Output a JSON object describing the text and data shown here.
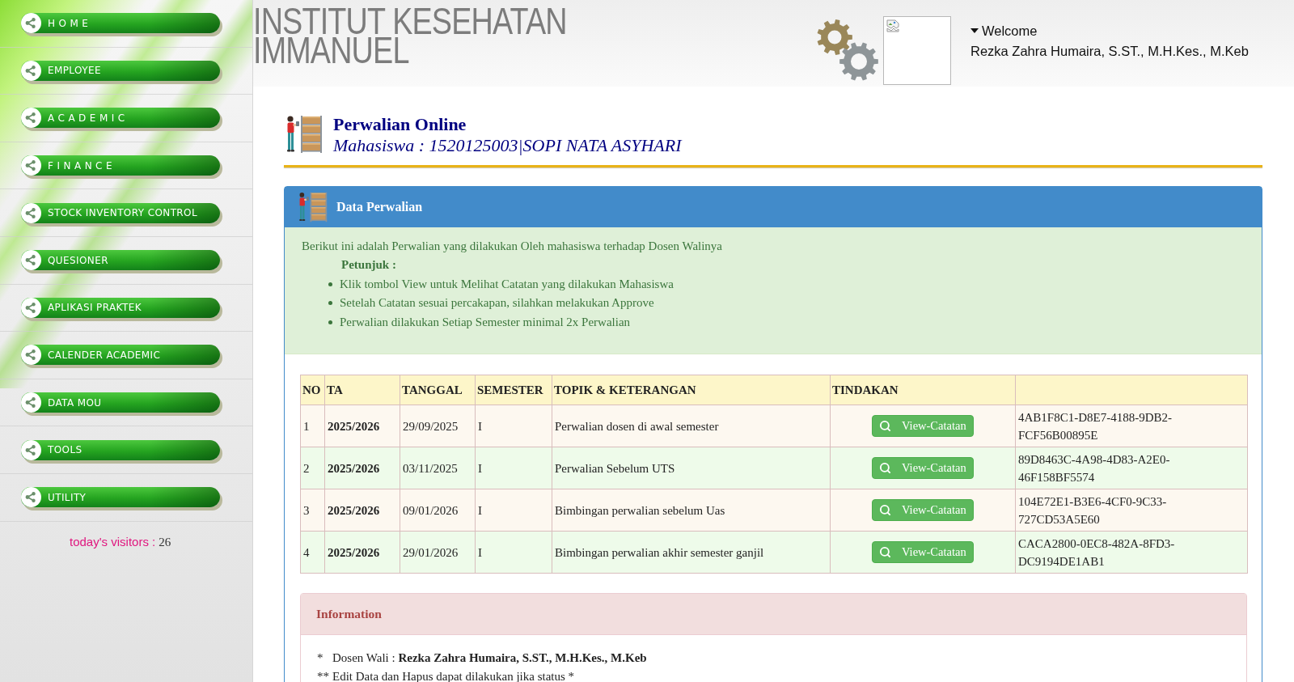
{
  "sidebar": {
    "menu": [
      {
        "label": "HOME",
        "kind": "spaced"
      },
      {
        "label": "EMPLOYEE",
        "kind": "plain"
      },
      {
        "label": "ACADEMIC",
        "kind": "spaced"
      },
      {
        "label": "FINANCE",
        "kind": "spaced"
      },
      {
        "label": "STOCK INVENTORY CONTROL",
        "kind": "plain"
      },
      {
        "label": "QUESIONER",
        "kind": "plain"
      },
      {
        "label": "APLIKASI PRAKTEK",
        "kind": "plain"
      },
      {
        "label": "CALENDER ACADEMIC",
        "kind": "plain"
      },
      {
        "label": "DATA MOU",
        "kind": "plain"
      },
      {
        "label": "TOOLS",
        "kind": "plain"
      },
      {
        "label": "UTILITY",
        "kind": "plain"
      }
    ],
    "visitors": {
      "label": "today's visitors :",
      "count": "26"
    }
  },
  "header": {
    "logo": [
      "INSTITUT KESEHATAN",
      "IMMANUEL"
    ],
    "welcome": "Welcome",
    "user_name": "Rezka Zahra Humaira, S.ST., M.H.Kes., M.Keb"
  },
  "page": {
    "title": "Perwalian Online",
    "subtitle": "Mahasiswa : 1520125003|SOPI NATA ASYHARI"
  },
  "panel": {
    "title": "Data Perwalian",
    "intro": "Berikut ini adalah Perwalian yang dilakukan Oleh mahasiswa terhadap Dosen Walinya",
    "hint_title": "Petunjuk :",
    "hints": [
      "Klik tombol View untuk Melihat Catatan yang dilakukan Mahasiswa",
      "Setelah Catatan sesuai percakapan, silahkan melakukan Approve",
      "Perwalian dilakukan Setiap Semester minimal 2x Perwalian"
    ]
  },
  "table": {
    "columns": [
      "NO",
      "TA",
      "TANGGAL",
      "SEMESTER",
      "TOPIK & KETERANGAN",
      "TINDAKAN"
    ],
    "rows": [
      {
        "no": "1",
        "ta": "2025/2026",
        "tanggal": "29/09/2025",
        "semester": "I",
        "topik": "Perwalian dosen di awal semester",
        "action": "View-Catatan",
        "code": "4AB1F8C1-D8E7-4188-9DB2-FCF56B00895E"
      },
      {
        "no": "2",
        "ta": "2025/2026",
        "tanggal": "03/11/2025",
        "semester": "I",
        "topik": "Perwalian Sebelum UTS",
        "action": "View-Catatan",
        "code": "89D8463C-4A98-4D83-A2E0-46F158BF5574"
      },
      {
        "no": "3",
        "ta": "2025/2026",
        "tanggal": "09/01/2026",
        "semester": "I",
        "topik": "Bimbingan perwalian sebelum Uas",
        "action": "View-Catatan",
        "code": "104E72E1-B3E6-4CF0-9C33-727CD53A5E60"
      },
      {
        "no": "4",
        "ta": "2025/2026",
        "tanggal": "29/01/2026",
        "semester": "I",
        "topik": "Bimbingan perwalian akhir semester ganjil",
        "action": "View-Catatan",
        "code": "CACA2800-0EC8-482A-8FD3-DC9194DE1AB1"
      }
    ]
  },
  "information": {
    "title": "Information",
    "notes": [
      {
        "marker": "*",
        "text": "Dosen Wali : **Rezka Zahra Humaira, S.ST., M.H.Kes., M.Keb**"
      },
      {
        "marker": "**",
        "text": "Edit Data dan Hapus dapat dilakukan jika status *"
      }
    ]
  }
}
